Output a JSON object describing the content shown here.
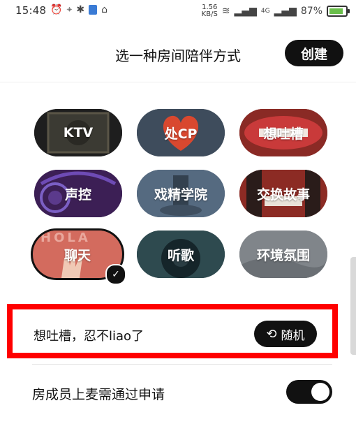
{
  "status_bar": {
    "time": "15:48",
    "net_speed_value": "1.56",
    "net_speed_unit": "KB/S",
    "signal": "4G",
    "battery": "87%",
    "battery_level": 0.87
  },
  "header": {
    "title": "选一种房间陪伴方式",
    "create_label": "创建"
  },
  "room_types": [
    {
      "label": "KTV"
    },
    {
      "label": "处CP"
    },
    {
      "label": "想吐槽"
    },
    {
      "label": "声控"
    },
    {
      "label": "戏精学院"
    },
    {
      "label": "交换故事"
    },
    {
      "label": "聊天",
      "selected": true
    },
    {
      "label": "听歌"
    },
    {
      "label": "环境氛围"
    }
  ],
  "topic": {
    "text": "想吐槽，忍不liao了",
    "random_label": "随机"
  },
  "settings": {
    "mic_approval_label": "房成员上麦需通过申请",
    "mic_approval_on": true
  },
  "colors": {
    "accent": "#111111",
    "highlight_border": "#ff0000",
    "battery_fill": "#6abf4b"
  }
}
